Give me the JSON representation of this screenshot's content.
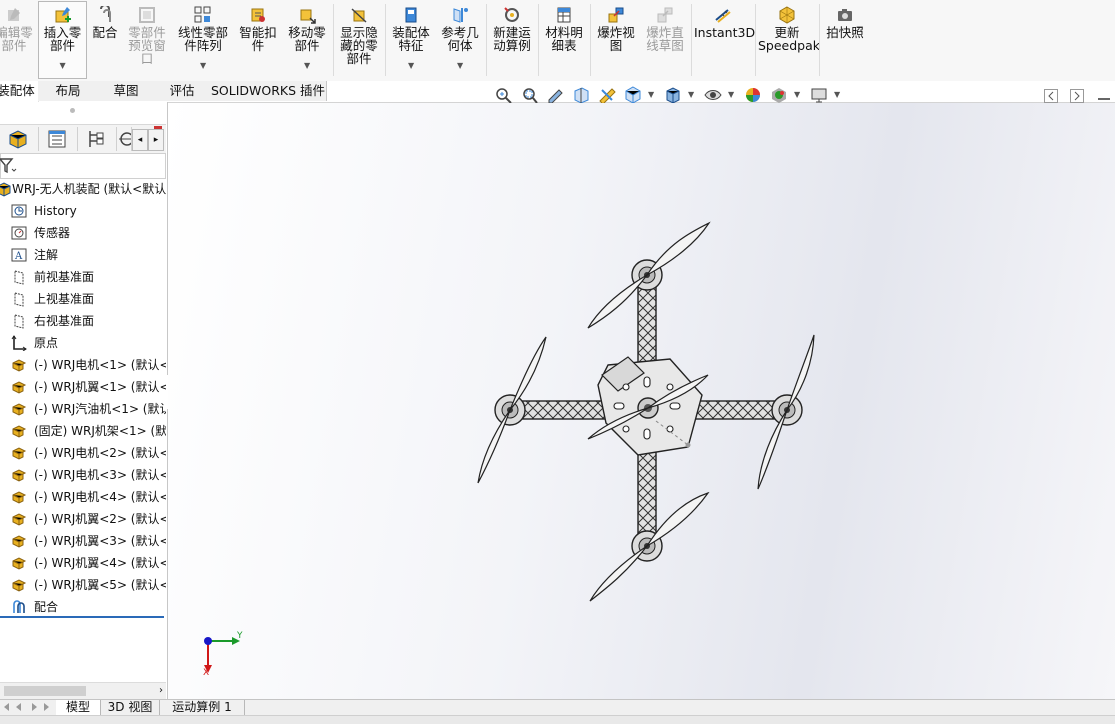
{
  "ribbon": {
    "edit_component": "编辑零\n部件",
    "insert_component": "插入零\n部件",
    "mate": "配合",
    "component_preview": "零部件\n预览窗\n口",
    "linear_pattern": "线性零部\n件阵列",
    "smart_fasteners": "智能扣\n件",
    "move_component": "移动零\n部件",
    "show_hidden": "显示隐\n藏的零\n部件",
    "assembly_features": "装配体\n特征",
    "reference_geometry": "参考几\n何体",
    "new_motion_study": "新建运\n动算例",
    "bill_of_materials": "材料明\n细表",
    "exploded_view": "爆炸视\n图",
    "explode_line_sketch": "爆炸直\n线草图",
    "instant3d": "Instant3D",
    "update_speedpak": "更新\nSpeedpak",
    "take_snapshot": "拍快照"
  },
  "command_tabs": [
    "装配体",
    "布局",
    "草图",
    "评估",
    "SOLIDWORKS 插件"
  ],
  "tree": {
    "root": "WRJ-无人机装配 (默认<默认",
    "items": [
      {
        "label": "History",
        "icon": "history-icon"
      },
      {
        "label": "传感器",
        "icon": "sensor-icon"
      },
      {
        "label": "注解",
        "icon": "annotation-icon"
      },
      {
        "label": "前视基准面",
        "icon": "plane-icon"
      },
      {
        "label": "上视基准面",
        "icon": "plane-icon"
      },
      {
        "label": "右视基准面",
        "icon": "plane-icon"
      },
      {
        "label": "原点",
        "icon": "origin-icon"
      },
      {
        "label": "(-) WRJ电机<1> (默认<",
        "icon": "part-icon"
      },
      {
        "label": "(-) WRJ机翼<1> (默认<",
        "icon": "part-icon"
      },
      {
        "label": "(-) WRJ汽油机<1> (默认",
        "icon": "part-icon"
      },
      {
        "label": "(固定) WRJ机架<1> (默",
        "icon": "part-icon"
      },
      {
        "label": "(-) WRJ电机<2> (默认<",
        "icon": "part-icon"
      },
      {
        "label": "(-) WRJ电机<3> (默认<",
        "icon": "part-icon"
      },
      {
        "label": "(-) WRJ电机<4> (默认<",
        "icon": "part-icon"
      },
      {
        "label": "(-) WRJ机翼<2> (默认<",
        "icon": "part-icon"
      },
      {
        "label": "(-) WRJ机翼<3> (默认<",
        "icon": "part-icon"
      },
      {
        "label": "(-) WRJ机翼<4> (默认<",
        "icon": "part-icon"
      },
      {
        "label": "(-) WRJ机翼<5> (默认<",
        "icon": "part-icon"
      },
      {
        "label": "配合",
        "icon": "mates-icon"
      }
    ]
  },
  "triad": {
    "y_label": "Y",
    "x_label": "X"
  },
  "bottom_tabs": [
    "模型",
    "3D 视图",
    "运动算例 1"
  ],
  "colors": {
    "accent": "#2a6ab8",
    "part_yellow": "#e8b020",
    "triad_x": "#d01818",
    "triad_y": "#1a9a2a",
    "triad_z": "#1818c8"
  }
}
